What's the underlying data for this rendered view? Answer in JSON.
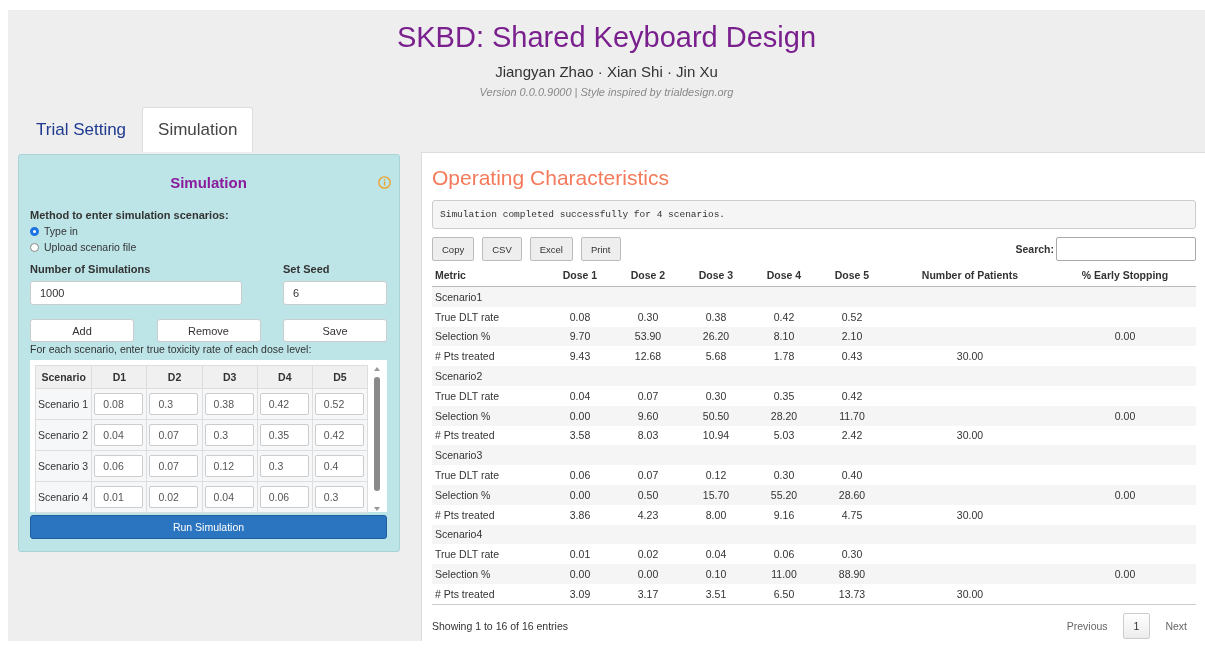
{
  "header": {
    "title": "SKBD: Shared Keyboard Design",
    "authors": "Jiangyan Zhao · Xian Shi · Jin Xu",
    "version": "Version 0.0.0.9000 | Style inspired by trialdesign.org"
  },
  "tabs": [
    {
      "label": "Trial Setting",
      "selected": false
    },
    {
      "label": "Simulation",
      "selected": true
    }
  ],
  "panel": {
    "title": "Simulation",
    "method_label": "Method to enter simulation scenarios:",
    "methods": [
      {
        "label": "Type in",
        "selected": true
      },
      {
        "label": "Upload scenario file",
        "selected": false
      }
    ],
    "fields": [
      {
        "label": "Number of Simulations",
        "value": "1000"
      },
      {
        "label": "Set Seed",
        "value": "6"
      }
    ],
    "buttons": [
      "Add",
      "Remove",
      "Save"
    ],
    "instruction": "For each scenario, enter true toxicity rate of each dose level:",
    "scenario_table": {
      "columns": [
        "Scenario",
        "D1",
        "D2",
        "D3",
        "D4",
        "D5"
      ],
      "rows": [
        {
          "name": "Scenario 1",
          "values": [
            "0.08",
            "0.3",
            "0.38",
            "0.42",
            "0.52"
          ]
        },
        {
          "name": "Scenario 2",
          "values": [
            "0.04",
            "0.07",
            "0.3",
            "0.35",
            "0.42"
          ]
        },
        {
          "name": "Scenario 3",
          "values": [
            "0.06",
            "0.07",
            "0.12",
            "0.3",
            "0.4"
          ]
        },
        {
          "name": "Scenario 4",
          "values": [
            "0.01",
            "0.02",
            "0.04",
            "0.06",
            "0.3"
          ]
        }
      ]
    },
    "run_button": "Run Simulation"
  },
  "results": {
    "title": "Operating Characteristics",
    "message": "Simulation completed successfully for 4 scenarios.",
    "export_buttons": [
      "Copy",
      "CSV",
      "Excel",
      "Print"
    ],
    "search_label": "Search:",
    "columns": [
      "Metric",
      "Dose 1",
      "Dose 2",
      "Dose 3",
      "Dose 4",
      "Dose 5",
      "Number of Patients",
      "% Early Stopping"
    ],
    "rows": [
      {
        "kind": "group",
        "metric": "Scenario1"
      },
      {
        "kind": "data",
        "metric": "True DLT rate",
        "doses": [
          "0.08",
          "0.30",
          "0.38",
          "0.42",
          "0.52"
        ]
      },
      {
        "kind": "data",
        "metric": "Selection %",
        "doses": [
          "9.70",
          "53.90",
          "26.20",
          "8.10",
          "2.10"
        ],
        "early_stopping": "0.00"
      },
      {
        "kind": "data",
        "metric": "# Pts treated",
        "doses": [
          "9.43",
          "12.68",
          "5.68",
          "1.78",
          "0.43"
        ],
        "patients": "30.00"
      },
      {
        "kind": "group",
        "metric": "Scenario2"
      },
      {
        "kind": "data",
        "metric": "True DLT rate",
        "doses": [
          "0.04",
          "0.07",
          "0.30",
          "0.35",
          "0.42"
        ]
      },
      {
        "kind": "data",
        "metric": "Selection %",
        "doses": [
          "0.00",
          "9.60",
          "50.50",
          "28.20",
          "11.70"
        ],
        "early_stopping": "0.00"
      },
      {
        "kind": "data",
        "metric": "# Pts treated",
        "doses": [
          "3.58",
          "8.03",
          "10.94",
          "5.03",
          "2.42"
        ],
        "patients": "30.00"
      },
      {
        "kind": "group",
        "metric": "Scenario3"
      },
      {
        "kind": "data",
        "metric": "True DLT rate",
        "doses": [
          "0.06",
          "0.07",
          "0.12",
          "0.30",
          "0.40"
        ]
      },
      {
        "kind": "data",
        "metric": "Selection %",
        "doses": [
          "0.00",
          "0.50",
          "15.70",
          "55.20",
          "28.60"
        ],
        "early_stopping": "0.00"
      },
      {
        "kind": "data",
        "metric": "# Pts treated",
        "doses": [
          "3.86",
          "4.23",
          "8.00",
          "9.16",
          "4.75"
        ],
        "patients": "30.00"
      },
      {
        "kind": "group",
        "metric": "Scenario4"
      },
      {
        "kind": "data",
        "metric": "True DLT rate",
        "doses": [
          "0.01",
          "0.02",
          "0.04",
          "0.06",
          "0.30"
        ]
      },
      {
        "kind": "data",
        "metric": "Selection %",
        "doses": [
          "0.00",
          "0.00",
          "0.10",
          "11.00",
          "88.90"
        ],
        "early_stopping": "0.00"
      },
      {
        "kind": "data",
        "metric": "# Pts treated",
        "doses": [
          "3.09",
          "3.17",
          "3.51",
          "6.50",
          "13.73"
        ],
        "patients": "30.00"
      }
    ],
    "info": "Showing 1 to 16 of 16 entries",
    "pagination": [
      {
        "label": "Previous",
        "kind": "nav",
        "disabled": true,
        "selected": false
      },
      {
        "label": "1",
        "kind": "page",
        "disabled": false,
        "selected": true
      },
      {
        "label": "Next",
        "kind": "nav",
        "disabled": true,
        "selected": false
      }
    ]
  }
}
